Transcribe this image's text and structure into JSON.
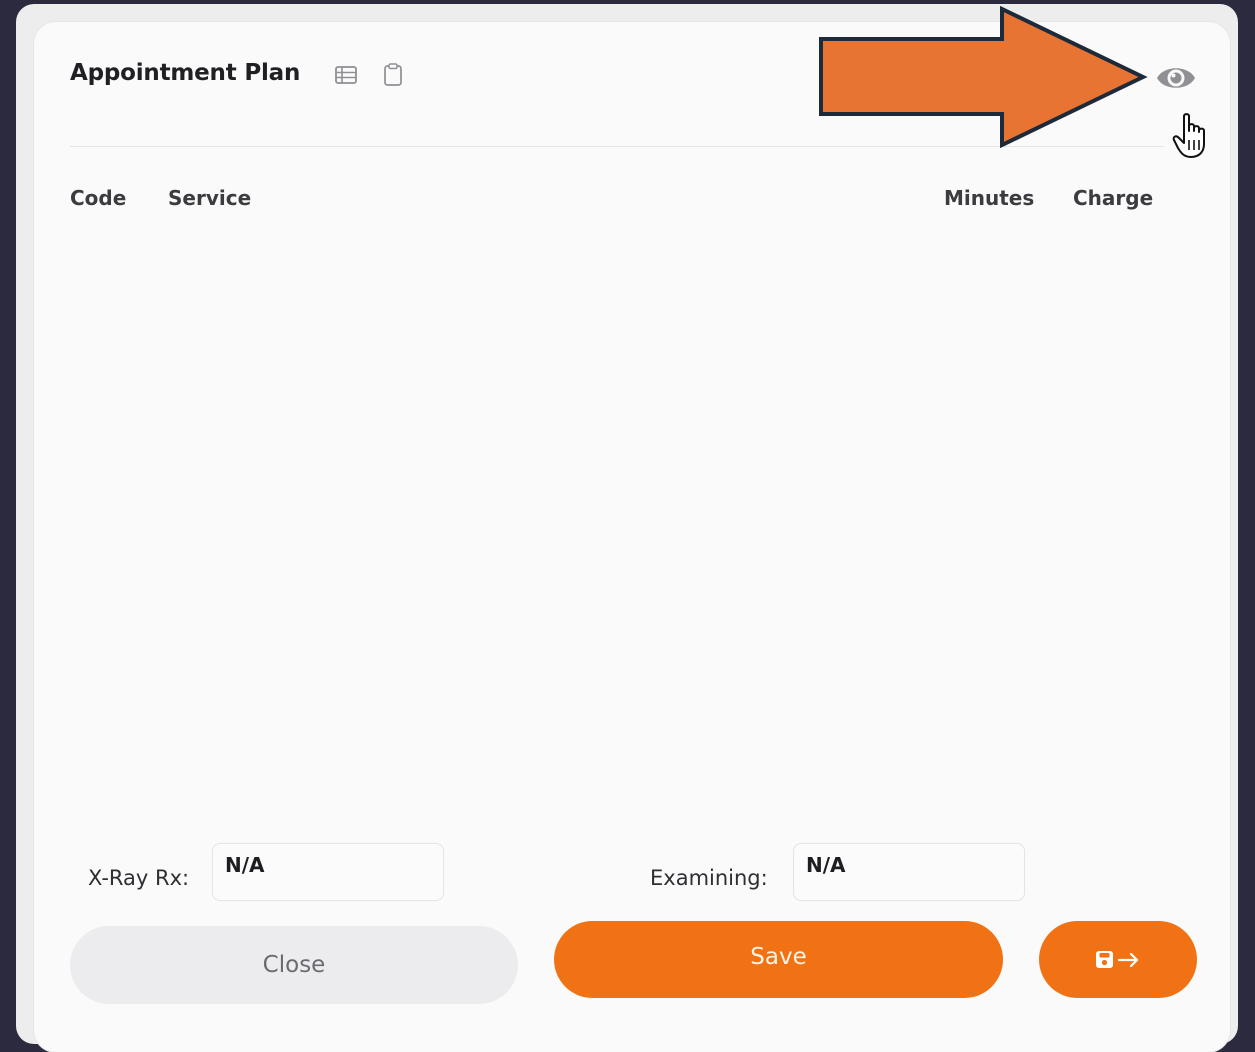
{
  "header": {
    "title": "Appointment Plan",
    "icons": [
      "list-icon",
      "clipboard-icon",
      "eye-icon"
    ]
  },
  "table": {
    "columns": [
      "Code",
      "Service",
      "Minutes",
      "Charge"
    ],
    "rows": []
  },
  "fields": {
    "xray_label": "X-Ray Rx:",
    "xray_value": "N/A",
    "examining_label": "Examining:",
    "examining_value": "N/A"
  },
  "buttons": {
    "close_label": "Close",
    "save_label": "Save",
    "save_exit_icon": "save-and-exit-icon"
  },
  "colors": {
    "accent": "#f07214",
    "annotation_arrow": "#e87434",
    "background": "#2b2a3e"
  }
}
